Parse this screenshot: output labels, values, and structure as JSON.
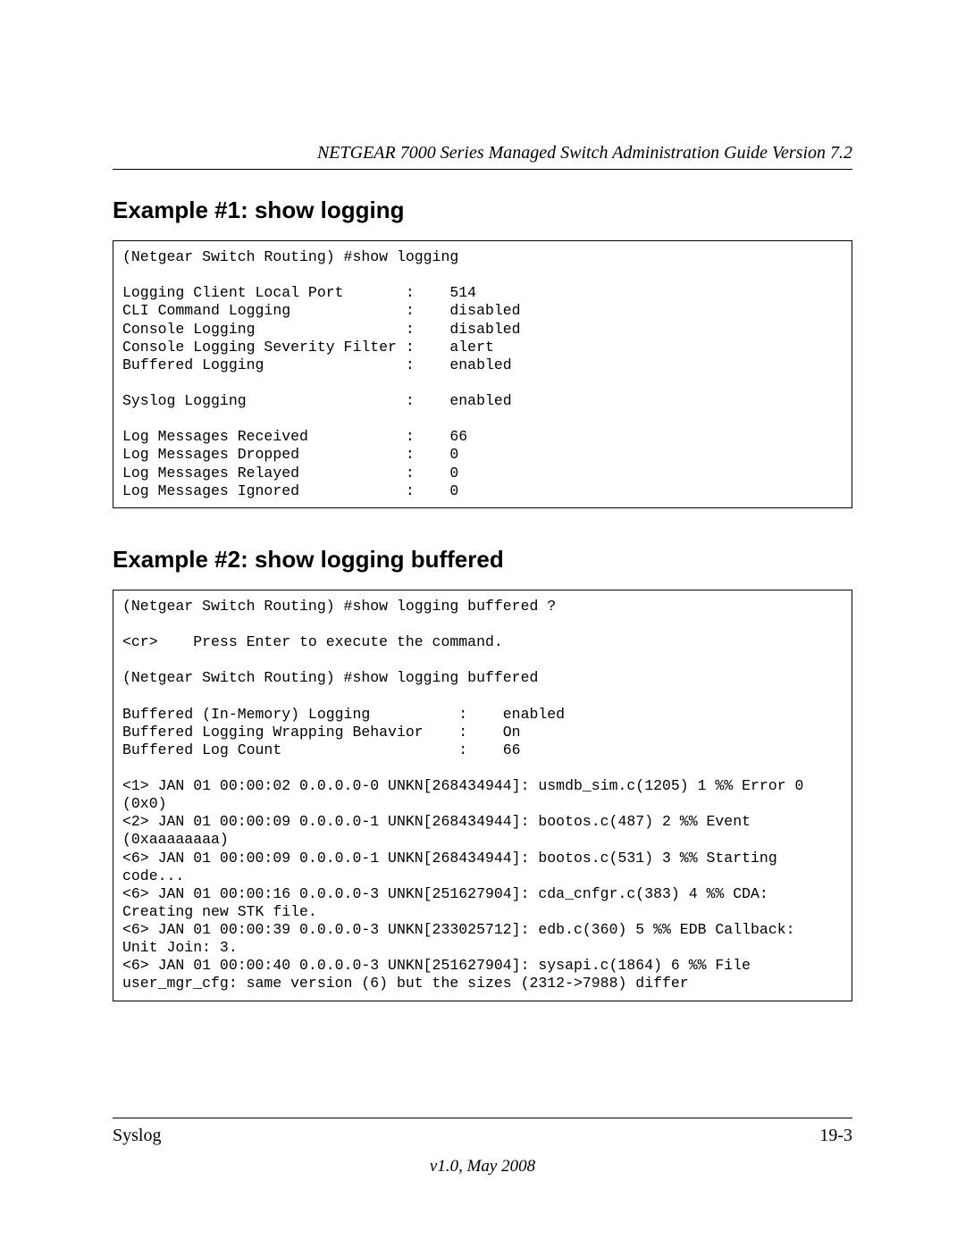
{
  "header": {
    "running_title": "NETGEAR 7000 Series Managed Switch Administration Guide Version 7.2"
  },
  "sections": {
    "ex1": {
      "heading": "Example #1: show logging",
      "code": "(Netgear Switch Routing) #show logging\n\nLogging Client Local Port       :    514\nCLI Command Logging             :    disabled\nConsole Logging                 :    disabled\nConsole Logging Severity Filter :    alert\nBuffered Logging                :    enabled\n\nSyslog Logging                  :    enabled\n\nLog Messages Received           :    66\nLog Messages Dropped            :    0\nLog Messages Relayed            :    0\nLog Messages Ignored            :    0"
    },
    "ex2": {
      "heading": "Example #2: show logging buffered",
      "code": "(Netgear Switch Routing) #show logging buffered ?\n\n<cr>    Press Enter to execute the command.\n\n(Netgear Switch Routing) #show logging buffered\n\nBuffered (In-Memory) Logging          :    enabled\nBuffered Logging Wrapping Behavior    :    On\nBuffered Log Count                    :    66\n\n<1> JAN 01 00:00:02 0.0.0.0-0 UNKN[268434944]: usmdb_sim.c(1205) 1 %% Error 0 \n(0x0)\n<2> JAN 01 00:00:09 0.0.0.0-1 UNKN[268434944]: bootos.c(487) 2 %% Event \n(0xaaaaaaaa)\n<6> JAN 01 00:00:09 0.0.0.0-1 UNKN[268434944]: bootos.c(531) 3 %% Starting \ncode...\n<6> JAN 01 00:00:16 0.0.0.0-3 UNKN[251627904]: cda_cnfgr.c(383) 4 %% CDA: \nCreating new STK file.\n<6> JAN 01 00:00:39 0.0.0.0-3 UNKN[233025712]: edb.c(360) 5 %% EDB Callback: \nUnit Join: 3.\n<6> JAN 01 00:00:40 0.0.0.0-3 UNKN[251627904]: sysapi.c(1864) 6 %% File \nuser_mgr_cfg: same version (6) but the sizes (2312->7988) differ"
    }
  },
  "footer": {
    "left": "Syslog",
    "right": "19-3",
    "version": "v1.0, May 2008"
  }
}
